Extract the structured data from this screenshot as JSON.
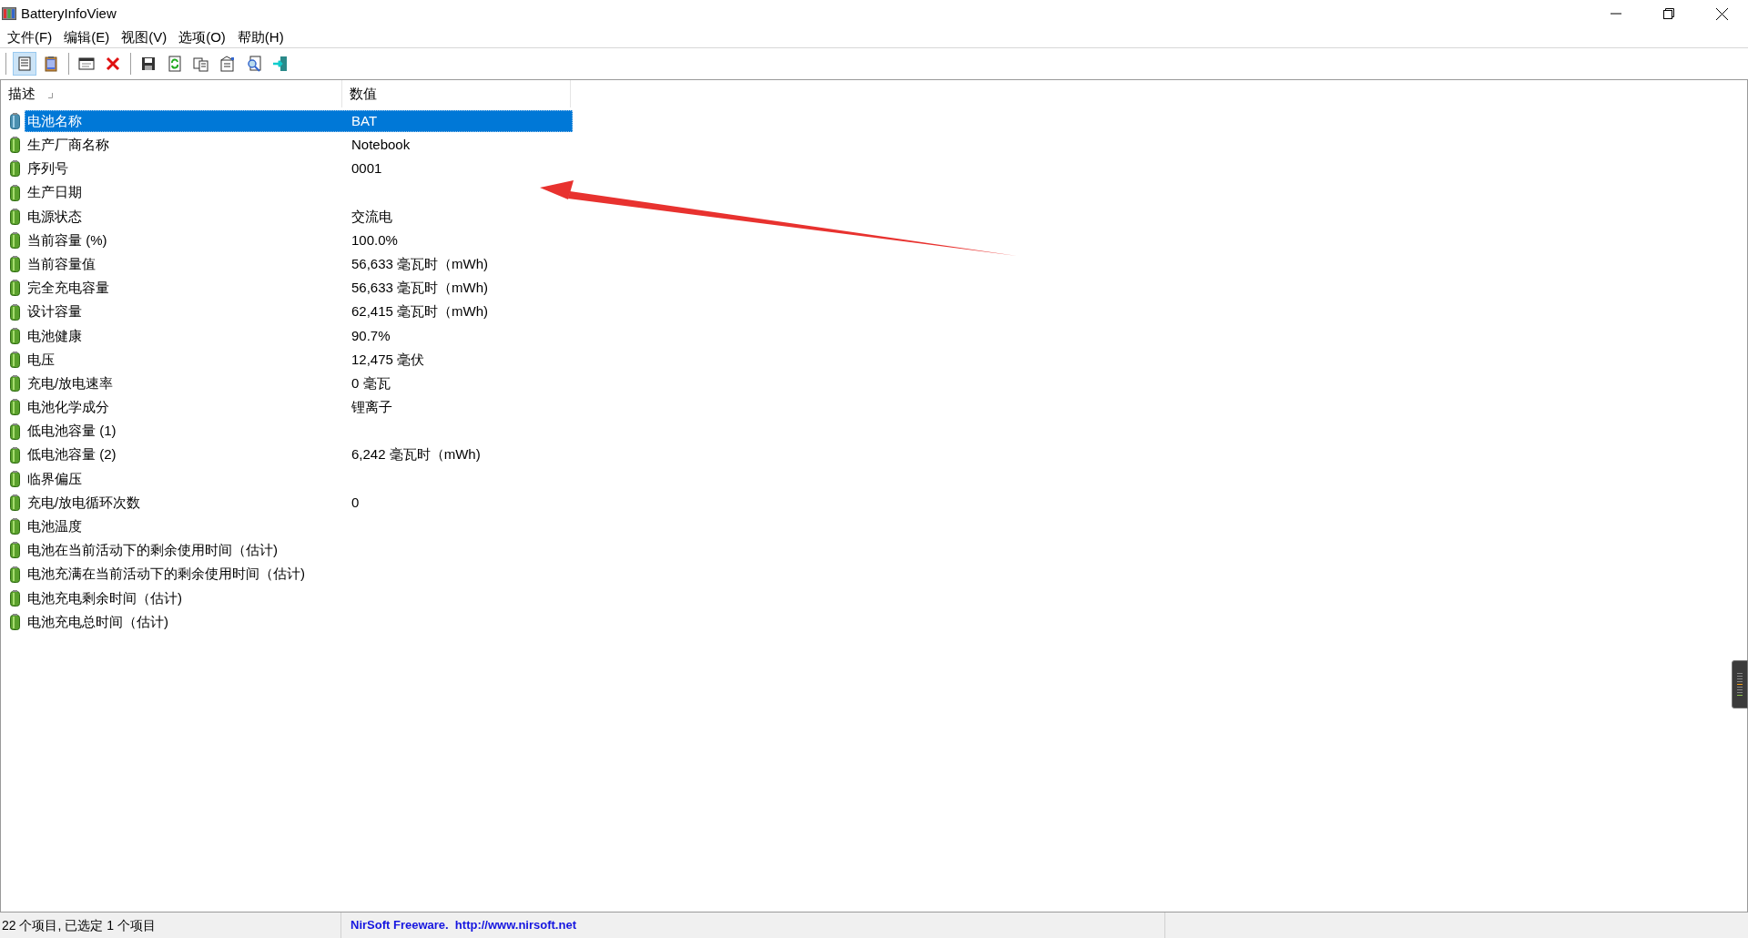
{
  "window": {
    "title": "BatteryInfoView"
  },
  "menu": [
    "文件(F)",
    "编辑(E)",
    "视图(V)",
    "选项(O)",
    "帮助(H)"
  ],
  "toolbar": [
    {
      "kind": "detail",
      "pressed": true
    },
    {
      "kind": "clipboard",
      "pressed": false
    },
    {
      "kind": "separator"
    },
    {
      "kind": "window",
      "pressed": false
    },
    {
      "kind": "delete",
      "pressed": false
    },
    {
      "kind": "separator"
    },
    {
      "kind": "save",
      "pressed": false
    },
    {
      "kind": "refresh",
      "pressed": false
    },
    {
      "kind": "copy",
      "pressed": false
    },
    {
      "kind": "properties",
      "pressed": false
    },
    {
      "kind": "find",
      "pressed": false
    },
    {
      "kind": "exit",
      "pressed": false
    }
  ],
  "table": {
    "columns": [
      "描述",
      "数值"
    ],
    "rows": [
      {
        "name": "电池名称",
        "value": "BAT",
        "selected": true
      },
      {
        "name": "生产厂商名称",
        "value": "Notebook",
        "selected": false
      },
      {
        "name": "序列号",
        "value": "0001",
        "selected": false
      },
      {
        "name": "生产日期",
        "value": "",
        "selected": false
      },
      {
        "name": "电源状态",
        "value": "交流电",
        "selected": false
      },
      {
        "name": "当前容量 (%)",
        "value": "100.0%",
        "selected": false
      },
      {
        "name": "当前容量值",
        "value": "56,633 毫瓦时（mWh)",
        "selected": false
      },
      {
        "name": "完全充电容量",
        "value": "56,633 毫瓦时（mWh)",
        "selected": false
      },
      {
        "name": "设计容量",
        "value": "62,415 毫瓦时（mWh)",
        "selected": false
      },
      {
        "name": "电池健康",
        "value": "90.7%",
        "selected": false
      },
      {
        "name": "电压",
        "value": "12,475 毫伏",
        "selected": false
      },
      {
        "name": "充电/放电速率",
        "value": "0 毫瓦",
        "selected": false
      },
      {
        "name": "电池化学成分",
        "value": "锂离子",
        "selected": false
      },
      {
        "name": "低电池容量 (1)",
        "value": "",
        "selected": false
      },
      {
        "name": "低电池容量 (2)",
        "value": "6,242 毫瓦时（mWh)",
        "selected": false
      },
      {
        "name": "临界偏压",
        "value": "",
        "selected": false
      },
      {
        "name": "充电/放电循环次数",
        "value": "0",
        "selected": false
      },
      {
        "name": "电池温度",
        "value": "",
        "selected": false
      },
      {
        "name": "电池在当前活动下的剩余使用时间（估计)",
        "value": "",
        "selected": false
      },
      {
        "name": "电池充满在当前活动下的剩余使用时间（估计)",
        "value": "",
        "selected": false
      },
      {
        "name": "电池充电剩余时间（估计)",
        "value": "",
        "selected": false
      },
      {
        "name": "电池充电总时间（估计)",
        "value": "",
        "selected": false
      }
    ]
  },
  "status_bar": {
    "count": "22 个项目, 已选定 1 个项目",
    "credit": "NirSoft Freeware.  http://www.nirsoft.net"
  }
}
